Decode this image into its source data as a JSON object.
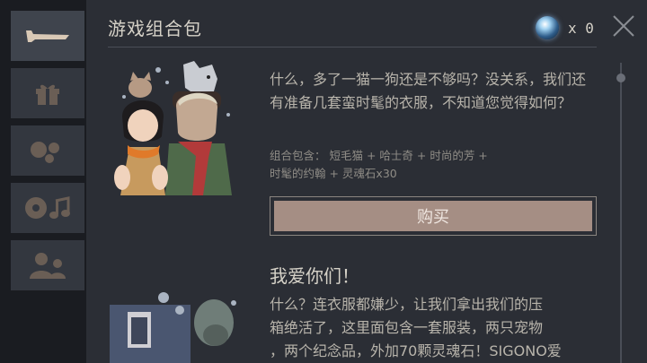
{
  "header": {
    "title": "游戏组合包",
    "currency_count": "x 0"
  },
  "sidebar": {
    "tabs": [
      {
        "name": "boat-icon",
        "active": true
      },
      {
        "name": "gift-icon",
        "active": false
      },
      {
        "name": "dots-icon",
        "active": false
      },
      {
        "name": "music-icon",
        "active": false
      },
      {
        "name": "people-icon",
        "active": false
      }
    ]
  },
  "offers": [
    {
      "description": "什么，多了一猫一狗还是不够吗？没关系，我们还有准备几套蛮时髦的衣服，不知道您觉得如何？",
      "contents_line1": "组合包含：  短毛猫 + 哈士奇 + 时尚的芳 +",
      "contents_line2": "时髦的约翰 + 灵魂石x30",
      "buy_label": "购买"
    },
    {
      "heading": "我爱你们！",
      "line1": "什么？连衣服都嫌少，让我们拿出我们的压",
      "line2": "箱绝活了，这里面包含一套服装，两只宠物",
      "line3": "，两个纪念品，外加70颗灵魂石！SIGONO爱"
    }
  ],
  "colors": {
    "background": "#2b2e35",
    "buy_button": "#a58e84"
  }
}
